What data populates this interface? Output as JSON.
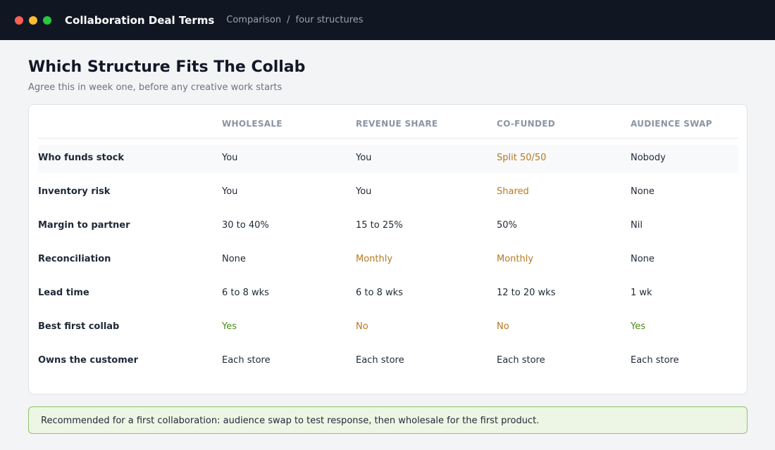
{
  "window": {
    "title": "Collaboration Deal Terms",
    "breadcrumb": [
      "Comparison",
      "four structures"
    ],
    "breadcrumb_separator": "/"
  },
  "page": {
    "title": "Which Structure Fits The Collab",
    "subtitle": "Agree this in week one, before any creative work starts"
  },
  "colors": {
    "accent_warn": "#b7791f",
    "accent_good": "#4d8c1c",
    "titlebar_bg": "#101722",
    "callout_bg": "#edf6e5",
    "callout_border": "#8cc46a"
  },
  "table": {
    "columns": [
      "WHOLESALE",
      "REVENUE SHARE",
      "CO-FUNDED",
      "AUDIENCE SWAP"
    ],
    "rows": [
      {
        "label": "Who funds stock",
        "cells": [
          {
            "text": "You",
            "tone": "neutral"
          },
          {
            "text": "You",
            "tone": "neutral"
          },
          {
            "text": "Split 50/50",
            "tone": "warn"
          },
          {
            "text": "Nobody",
            "tone": "neutral"
          }
        ]
      },
      {
        "label": "Inventory risk",
        "cells": [
          {
            "text": "You",
            "tone": "neutral"
          },
          {
            "text": "You",
            "tone": "neutral"
          },
          {
            "text": "Shared",
            "tone": "warn"
          },
          {
            "text": "None",
            "tone": "neutral"
          }
        ]
      },
      {
        "label": "Margin to partner",
        "cells": [
          {
            "text": "30 to 40%",
            "tone": "neutral"
          },
          {
            "text": "15 to 25%",
            "tone": "neutral"
          },
          {
            "text": "50%",
            "tone": "neutral"
          },
          {
            "text": "Nil",
            "tone": "neutral"
          }
        ]
      },
      {
        "label": "Reconciliation",
        "cells": [
          {
            "text": "None",
            "tone": "neutral"
          },
          {
            "text": "Monthly",
            "tone": "warn"
          },
          {
            "text": "Monthly",
            "tone": "warn"
          },
          {
            "text": "None",
            "tone": "neutral"
          }
        ]
      },
      {
        "label": "Lead time",
        "cells": [
          {
            "text": "6 to 8 wks",
            "tone": "neutral"
          },
          {
            "text": "6 to 8 wks",
            "tone": "neutral"
          },
          {
            "text": "12 to 20 wks",
            "tone": "neutral"
          },
          {
            "text": "1 wk",
            "tone": "neutral"
          }
        ]
      },
      {
        "label": "Best first collab",
        "cells": [
          {
            "text": "Yes",
            "tone": "good"
          },
          {
            "text": "No",
            "tone": "warn"
          },
          {
            "text": "No",
            "tone": "warn"
          },
          {
            "text": "Yes",
            "tone": "good"
          }
        ]
      },
      {
        "label": "Owns the customer",
        "cells": [
          {
            "text": "Each store",
            "tone": "neutral"
          },
          {
            "text": "Each store",
            "tone": "neutral"
          },
          {
            "text": "Each store",
            "tone": "neutral"
          },
          {
            "text": "Each store",
            "tone": "neutral"
          }
        ]
      }
    ]
  },
  "callout": {
    "text": "Recommended for a first collaboration: audience swap to test response, then wholesale for the first product."
  }
}
